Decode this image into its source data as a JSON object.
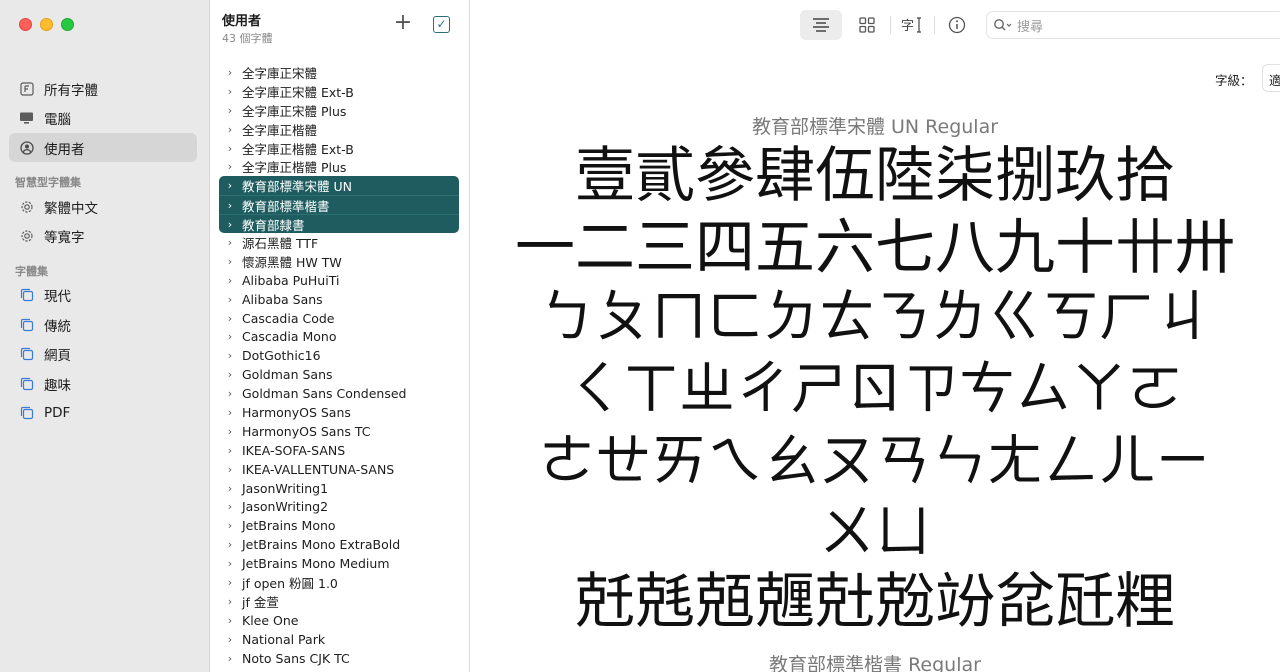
{
  "sidebar": {
    "items": [
      {
        "label": "所有字體",
        "icon": "font-f-icon"
      },
      {
        "label": "電腦",
        "icon": "computer-icon"
      },
      {
        "label": "使用者",
        "icon": "user-icon",
        "active": true
      }
    ],
    "smart_section": "智慧型字體集",
    "smart_items": [
      {
        "label": "繁體中文",
        "icon": "gear-icon"
      },
      {
        "label": "等寬字",
        "icon": "gear-icon"
      }
    ],
    "collections_section": "字體集",
    "collections": [
      {
        "label": "現代",
        "icon": "collection-icon"
      },
      {
        "label": "傳統",
        "icon": "collection-icon"
      },
      {
        "label": "網頁",
        "icon": "collection-icon"
      },
      {
        "label": "趣味",
        "icon": "collection-icon"
      },
      {
        "label": "PDF",
        "icon": "collection-icon"
      }
    ]
  },
  "fontlist": {
    "title": "使用者",
    "count": "43 個字體",
    "add_symbol": "+",
    "check_symbol": "✓",
    "fonts": [
      "全字庫正宋體",
      "全字庫正宋體 Ext-B",
      "全字庫正宋體 Plus",
      "全字庫正楷體",
      "全字庫正楷體 Ext-B",
      "全字庫正楷體 Plus",
      "教育部標準宋體 UN",
      "教育部標準楷書",
      "教育部隸書",
      "源石黑體 TTF",
      "懷源黑體 HW TW",
      "Alibaba PuHuiTi",
      "Alibaba Sans",
      "Cascadia Code",
      "Cascadia Mono",
      "DotGothic16",
      "Goldman Sans",
      "Goldman Sans Condensed",
      "HarmonyOS Sans",
      "HarmonyOS Sans TC",
      "IKEA-SOFA-SANS",
      "IKEA-VALLENTUNA-SANS",
      "JasonWriting1",
      "JasonWriting2",
      "JetBrains Mono",
      "JetBrains Mono ExtraBold",
      "JetBrains Mono Medium",
      "jf open 粉圓 1.0",
      "jf 金萱",
      "Klee One",
      "National Park",
      "Noto Sans CJK TC"
    ],
    "selected": [
      6,
      7,
      8
    ]
  },
  "toolbar": {
    "search_placeholder": "搜尋",
    "size_label": "字級：",
    "size_value": "適合視窗"
  },
  "preview": {
    "font_name_1": "教育部標準宋體 UN Regular",
    "lines": [
      "壹貳參肆伍陸柒捌玖拾",
      "一二三四五六七八九十卄卅",
      "ㄅㄆㄇㄈㄉㄊㄋㄌㄍㄎㄏㄐ",
      "ㄑㄒㄓㄔㄕㄖㄗㄘㄙㄚㄛ",
      "ㄜㄝㄞㄟㄠㄡㄢㄣㄤㄥㄦㄧ",
      "ㄨㄩ",
      "兛兞兡兣兙兝竕兺瓩粴"
    ],
    "font_name_2": "教育部標準楷書 Regular"
  }
}
